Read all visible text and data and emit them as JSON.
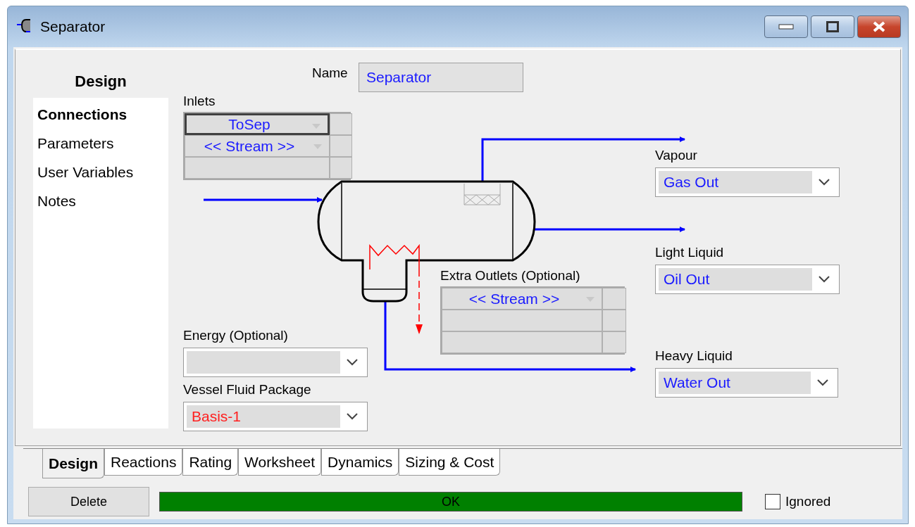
{
  "window": {
    "title": "Separator"
  },
  "sidebar": {
    "title": "Design",
    "items": [
      {
        "label": "Connections",
        "selected": true
      },
      {
        "label": "Parameters",
        "selected": false
      },
      {
        "label": "User Variables",
        "selected": false
      },
      {
        "label": "Notes",
        "selected": false
      }
    ]
  },
  "name_field": {
    "label": "Name",
    "value": "Separator"
  },
  "inlets": {
    "label": "Inlets",
    "rows": [
      {
        "value": "ToSep",
        "selected": true
      },
      {
        "value": "<< Stream >>",
        "selected": false
      }
    ]
  },
  "outlets": [
    {
      "label": "Vapour",
      "value": "Gas Out"
    },
    {
      "label": "Light Liquid",
      "value": "Oil Out"
    },
    {
      "label": "Heavy Liquid",
      "value": "Water Out"
    }
  ],
  "extra_outlets": {
    "label": "Extra Outlets (Optional)",
    "rows": [
      {
        "value": "<< Stream >>",
        "selected": false
      }
    ]
  },
  "energy": {
    "label": "Energy (Optional)"
  },
  "fluid_package": {
    "label": "Vessel Fluid Package",
    "value": "Basis-1"
  },
  "tabs": [
    {
      "label": "Design",
      "selected": true
    },
    {
      "label": "Reactions",
      "selected": false
    },
    {
      "label": "Rating",
      "selected": false
    },
    {
      "label": "Worksheet",
      "selected": false
    },
    {
      "label": "Dynamics",
      "selected": false
    },
    {
      "label": "Sizing & Cost",
      "selected": false
    }
  ],
  "delete_button": "Delete",
  "status": {
    "text": "OK",
    "color": "#008000"
  },
  "ignored": {
    "label": "Ignored",
    "checked": false
  }
}
